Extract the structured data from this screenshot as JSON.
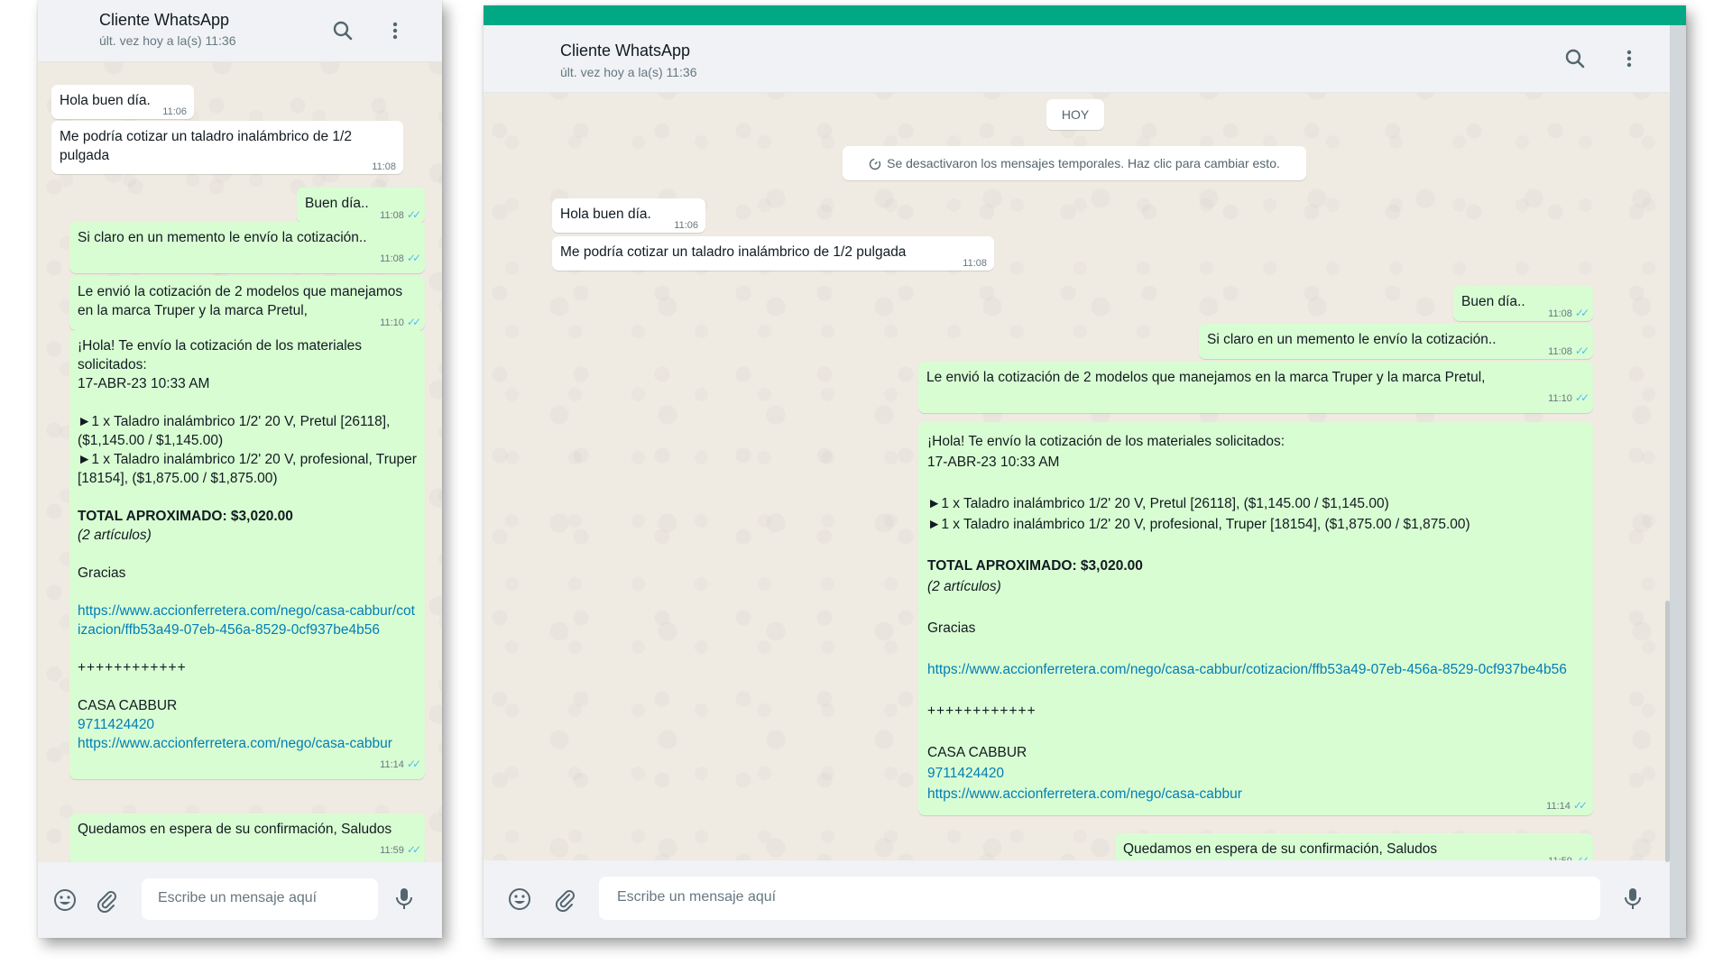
{
  "header": {
    "title": "Cliente WhatsApp",
    "status": "últ. vez hoy a la(s) 11:36"
  },
  "date_divider": "HOY",
  "system_notice": "Se desactivaron los mensajes temporales. Haz clic para cambiar esto.",
  "messages": {
    "m1": {
      "text": "Hola buen día.",
      "time": "11:06"
    },
    "m2": {
      "text": "Me podría cotizar un taladro inalámbrico de 1/2 pulgada",
      "time": "11:08"
    },
    "m3": {
      "text": "Buen día..",
      "time": "11:08"
    },
    "m4": {
      "text": "Si claro en un memento le envío la cotización..",
      "time": "11:08"
    },
    "m5": {
      "text": "Le envió la cotización de 2 modelos que manejamos en la marca Truper y la marca Pretul,",
      "time": "11:10"
    },
    "m6": {
      "intro_1": "¡Hola! Te envío la cotización de los materiales solicitados:",
      "date": "17-ABR-23 10:33 AM",
      "item_1": "►1 x Taladro inalámbrico 1/2' 20 V, Pretul [26118], ($1,145.00 / $1,145.00)",
      "item_2": "►1 x Taladro inalámbrico 1/2' 20 V, profesional, Truper [18154], ($1,875.00 / $1,875.00)",
      "total": "TOTAL APROXIMADO: $3,020.00",
      "count": "(2 artículos)",
      "thanks": "Gracias",
      "quote_link": "https://www.accionferretera.com/nego/casa-cabbur/cotizacion/ffb53a49-07eb-456a-8529-0cf937be4b56",
      "separator": "++++++++++++",
      "business": "CASA CABBUR",
      "phone": "9711424420",
      "site_link": "https://www.accionferretera.com/nego/casa-cabbur",
      "time": "11:14"
    },
    "m7": {
      "text": "Quedamos en espera de su confirmación, Saludos",
      "time": "11:59"
    }
  },
  "composer": {
    "placeholder": "Escribe un mensaje aquí"
  },
  "colors": {
    "accent": "#00a884",
    "outgoing_bubble": "#d9fdd3",
    "incoming_bubble": "#ffffff",
    "read_ticks": "#53bdeb",
    "link": "#027eb5"
  },
  "icons": [
    "search-icon",
    "menu-dots-icon",
    "emoji-icon",
    "attach-icon",
    "mic-icon",
    "timer-icon",
    "read-ticks-icon"
  ]
}
